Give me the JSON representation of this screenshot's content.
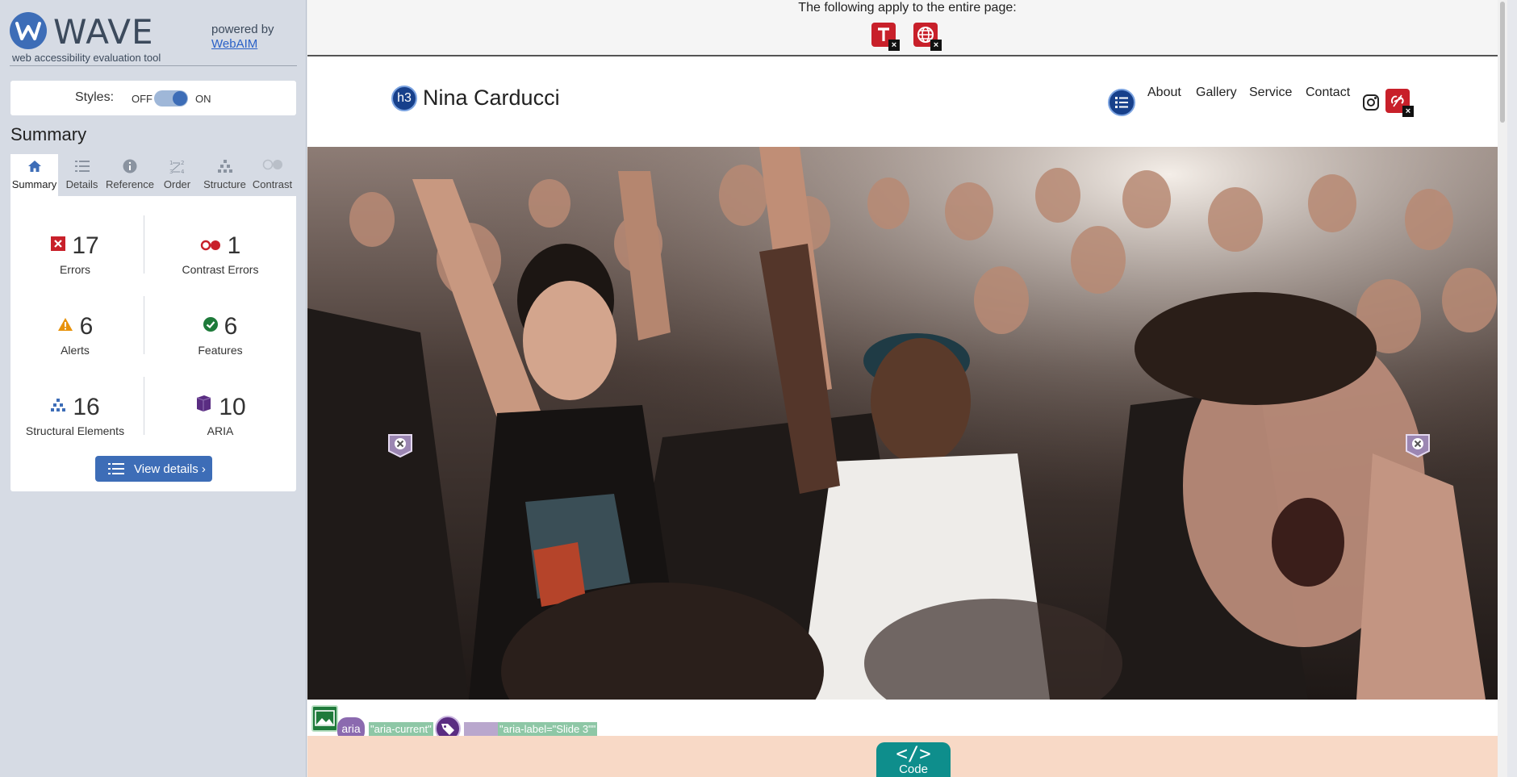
{
  "sidebar": {
    "brand": "WAVE",
    "tagline": "web accessibility evaluation tool",
    "powered_by": "powered by",
    "webaim_link": "WebAIM",
    "styles_label": "Styles:",
    "styles_off": "OFF",
    "styles_on": "ON",
    "summary_title": "Summary",
    "tabs": [
      {
        "label": "Summary",
        "icon": "home-icon"
      },
      {
        "label": "Details",
        "icon": "list-icon"
      },
      {
        "label": "Reference",
        "icon": "info-icon"
      },
      {
        "label": "Order",
        "icon": "order-icon"
      },
      {
        "label": "Structure",
        "icon": "structure-icon"
      },
      {
        "label": "Contrast",
        "icon": "contrast-icon"
      }
    ],
    "stats": {
      "errors": {
        "value": "17",
        "label": "Errors"
      },
      "contrast_errors": {
        "value": "1",
        "label": "Contrast Errors"
      },
      "alerts": {
        "value": "6",
        "label": "Alerts"
      },
      "features": {
        "value": "6",
        "label": "Features"
      },
      "structural": {
        "value": "16",
        "label": "Structural Elements"
      },
      "aria": {
        "value": "10",
        "label": "ARIA"
      }
    },
    "view_details": "View details ›"
  },
  "page": {
    "note": "The following apply to the entire page:",
    "site_title": "Nina Carducci",
    "h3_badge": "h3",
    "nav": [
      "About",
      "Gallery",
      "Service",
      "Contact"
    ],
    "aria_chip": "aria",
    "chip_current": "\"aria-current\"",
    "chip_label": "\"aria-label=\"Slide 3\"\"",
    "code_label": "Code",
    "code_icon": "</>"
  },
  "colors": {
    "accent": "#3d6db7",
    "error": "#c8202a",
    "aria": "#5a2d82",
    "feature": "#1e7a3a",
    "code": "#0e8e8c"
  }
}
